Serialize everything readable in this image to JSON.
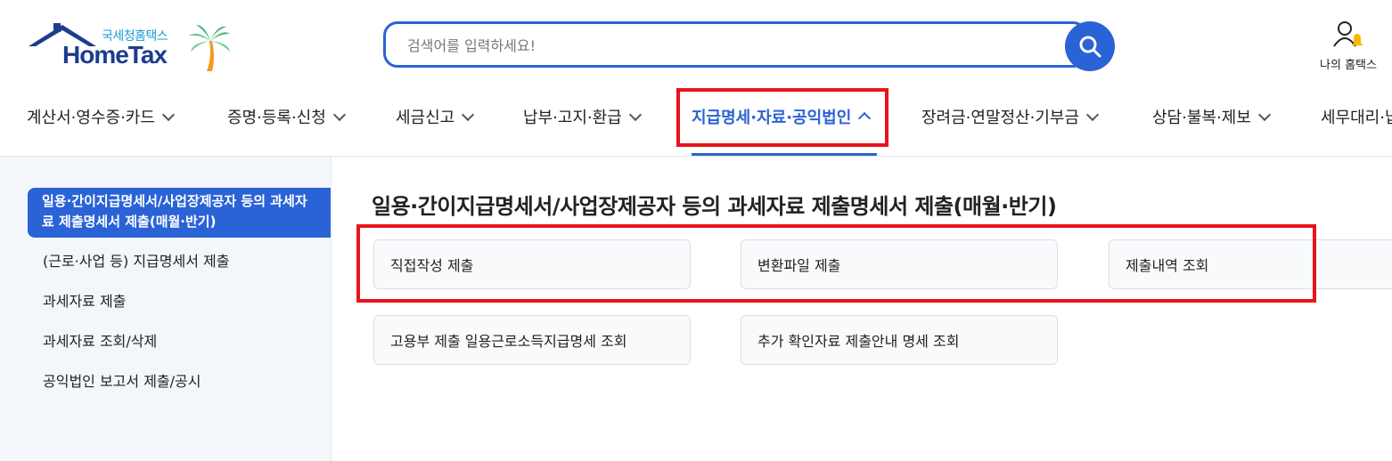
{
  "header": {
    "logo_sub": "국세청홈택스",
    "logo_main": "HomeTax",
    "search_placeholder": "검색어를 입력하세요!",
    "myhome_label": "나의 홈택스"
  },
  "nav": {
    "items": [
      {
        "label": "계산서·영수증·카드"
      },
      {
        "label": "증명·등록·신청"
      },
      {
        "label": "세금신고"
      },
      {
        "label": "납부·고지·환급"
      },
      {
        "label": "지급명세·자료·공익법인"
      },
      {
        "label": "장려금·연말정산·기부금"
      },
      {
        "label": "상담·불복·제보"
      },
      {
        "label": "세무대리·납"
      }
    ]
  },
  "sidebar": {
    "active_label": "일용·간이지급명세서/사업장제공자 등의 과세자료 제출명세서 제출(매월·반기)",
    "items": [
      {
        "label": "(근로·사업 등) 지급명세서 제출"
      },
      {
        "label": "과세자료 제출"
      },
      {
        "label": "과세자료 조회/삭제"
      },
      {
        "label": "공익법인 보고서 제출/공시"
      }
    ]
  },
  "main": {
    "title": "일용·간이지급명세서/사업장제공자 등의 과세자료 제출명세서 제출(매월·반기)",
    "cards": [
      {
        "label": "직접작성 제출"
      },
      {
        "label": "변환파일 제출"
      },
      {
        "label": "제출내역 조회"
      },
      {
        "label": "고용부 제출 일용근로소득지급명세 조회"
      },
      {
        "label": "추가 확인자료 제출안내 명세 조회"
      }
    ]
  },
  "colors": {
    "accent": "#2a63d6",
    "highlight_red": "#e8141b",
    "sidebar_bg": "#f3f6fb"
  }
}
